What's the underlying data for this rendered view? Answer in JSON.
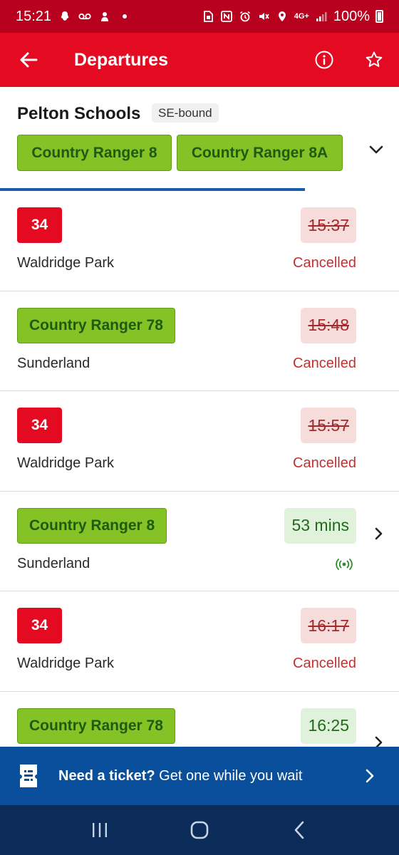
{
  "status_bar": {
    "time": "15:21",
    "network": "4G+",
    "battery": "100%"
  },
  "app_bar": {
    "title": "Departures"
  },
  "stop": {
    "name": "Pelton Schools",
    "bound": "SE-bound",
    "routes": [
      "Country Ranger 8",
      "Country Ranger 8A"
    ]
  },
  "departures": [
    {
      "route": "34",
      "route_style": "red",
      "destination": "Waldridge Park",
      "time": "15:37",
      "status": "Cancelled",
      "state": "cancelled"
    },
    {
      "route": "Country Ranger 78",
      "route_style": "green",
      "destination": "Sunderland",
      "time": "15:48",
      "status": "Cancelled",
      "state": "cancelled"
    },
    {
      "route": "34",
      "route_style": "red",
      "destination": "Waldridge Park",
      "time": "15:57",
      "status": "Cancelled",
      "state": "cancelled"
    },
    {
      "route": "Country Ranger 8",
      "route_style": "green",
      "destination": "Sunderland",
      "time": "53 mins",
      "status": "",
      "state": "live"
    },
    {
      "route": "34",
      "route_style": "red",
      "destination": "Waldridge Park",
      "time": "16:17",
      "status": "Cancelled",
      "state": "cancelled"
    },
    {
      "route": "Country Ranger 78",
      "route_style": "green",
      "destination": "",
      "time": "16:25",
      "status": "",
      "state": "scheduled"
    }
  ],
  "ticket_banner": {
    "bold": "Need a ticket?",
    "text": " Get one while you wait"
  },
  "colors": {
    "brand_red": "#e30a22",
    "route_green": "#84c225",
    "banner_blue": "#0a4f9c",
    "cancel_red": "#c53030"
  },
  "icons": {
    "back": "arrow-left-icon",
    "info": "info-icon",
    "favourite": "star-icon",
    "expand": "chevron-down-icon",
    "live": "live-signal-icon",
    "ticket": "ticket-icon"
  }
}
